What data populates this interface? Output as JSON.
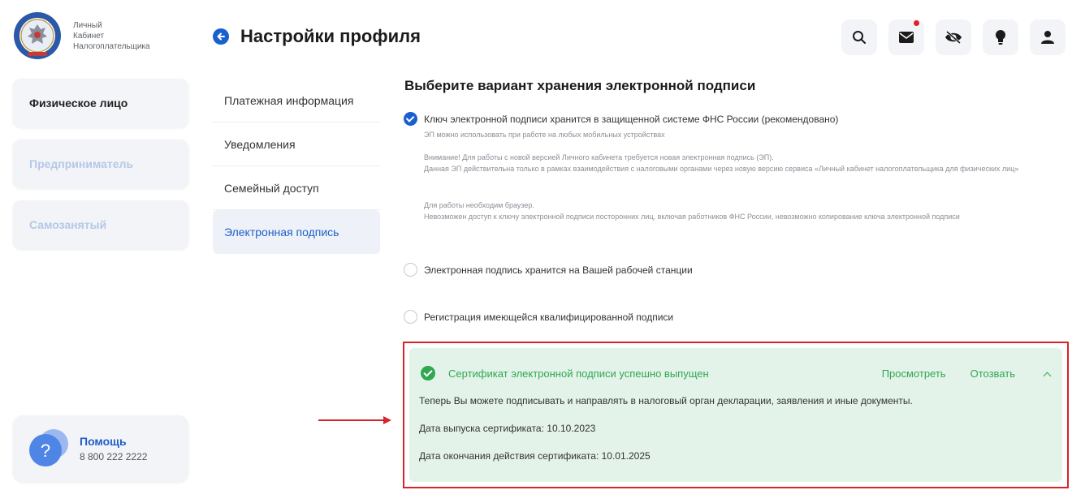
{
  "logo": {
    "lines": [
      "Личный",
      "Кабинет",
      "Налогоплательщика"
    ]
  },
  "sidebar": {
    "items": [
      {
        "label": "Физическое лицо",
        "active": true
      },
      {
        "label": "Предприниматель",
        "active": false
      },
      {
        "label": "Самозанятый",
        "active": false
      }
    ],
    "help": {
      "title": "Помощь",
      "phone": "8 800 222 2222"
    }
  },
  "header": {
    "title": "Настройки профиля",
    "icons": [
      "search-icon",
      "mail-icon",
      "eye-off-icon",
      "lightbulb-icon",
      "user-icon"
    ]
  },
  "submenu": {
    "items": [
      {
        "label": "Платежная информация",
        "selected": false
      },
      {
        "label": "Уведомления",
        "selected": false
      },
      {
        "label": "Семейный доступ",
        "selected": false
      },
      {
        "label": "Электронная подпись",
        "selected": true
      }
    ]
  },
  "main": {
    "section_title": "Выберите вариант хранения электронной подписи",
    "options": [
      {
        "label": "Ключ электронной подписи хранится в защищенной системе ФНС России (рекомендовано)",
        "checked": true
      },
      {
        "label": "Электронная подпись хранится на Вашей рабочей станции",
        "checked": false
      },
      {
        "label": "Регистрация имеющейся квалифицированной подписи",
        "checked": false
      }
    ],
    "notes": {
      "n1": "ЭП можно использовать при работе на любых мобильных устройствах",
      "n2a": "Внимание! Для работы с новой версией Личного кабинета требуется новая электронная подпись (ЭП).",
      "n2b": "Данная ЭП действительна только в рамках взаимодействия с налоговыми органами через новую версию сервиса «Личный кабинет налогоплательщика для физических лиц»",
      "n3a": "Для работы необходим браузер.",
      "n3b": "Невозможен доступ к ключу электронной подписи посторонних лиц, включая работников ФНС России, невозможно копирование ключа электронной подписи"
    },
    "success": {
      "title": "Сертификат электронной подписи успешно выпущен",
      "view": "Просмотреть",
      "revoke": "Отозвать",
      "message": "Теперь Вы можете подписывать и направлять в налоговый орган декларации, заявления и иные документы.",
      "issue_date": "Дата выпуска сертификата: 10.10.2023",
      "expiry_date": "Дата окончания действия сертификата: 10.01.2025"
    }
  },
  "colors": {
    "accent": "#1a5fd0",
    "success": "#2fa84f",
    "success_bg": "#e3f3ea",
    "highlight": "#d8232a",
    "inactive_nav": "#b5c8e6"
  }
}
